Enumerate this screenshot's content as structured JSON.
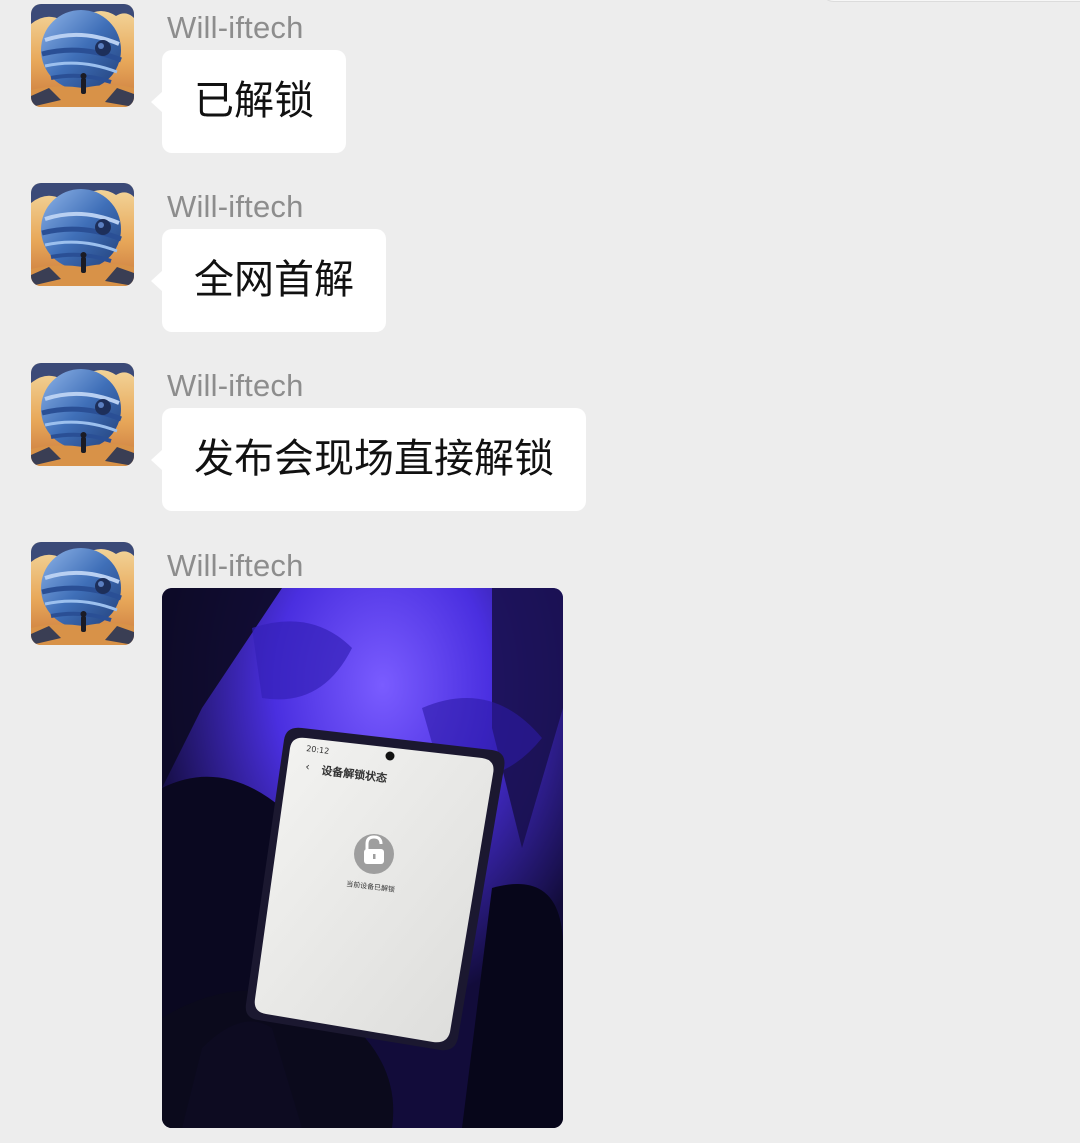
{
  "messages": [
    {
      "sender": "Will-iftech",
      "type": "text",
      "text": "已解锁"
    },
    {
      "sender": "Will-iftech",
      "type": "text",
      "text": "全网首解"
    },
    {
      "sender": "Will-iftech",
      "type": "text",
      "text": "发布会现场直接解锁"
    },
    {
      "sender": "Will-iftech",
      "type": "image",
      "image_content": {
        "status_time": "20:12",
        "screen_title": "设备解锁状态",
        "status_text": "当前设备已解锁"
      }
    }
  ],
  "avatar_icon": "planet-astronaut-avatar",
  "colors": {
    "background": "#ededed",
    "bubble": "#ffffff",
    "sender_name": "#8d8d8d",
    "photo_accent": "#5a3cff"
  }
}
